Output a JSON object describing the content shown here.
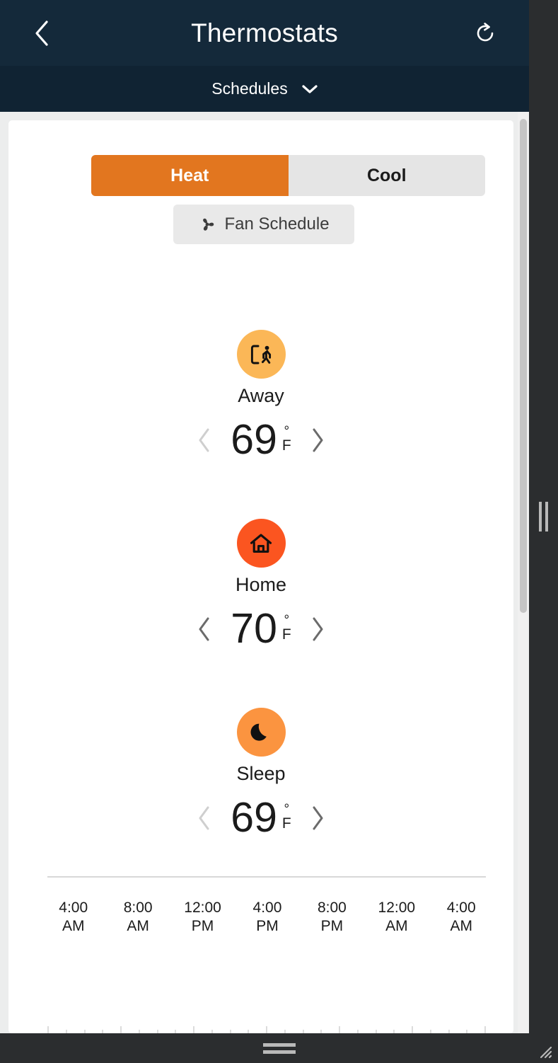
{
  "window": {
    "header": {
      "title": "Thermostats",
      "back_icon": "chevron-left-icon",
      "refresh_icon": "refresh-icon"
    },
    "subbar": {
      "label": "Schedules",
      "chevron_icon": "chevron-down-icon"
    }
  },
  "mode_tabs": {
    "items": [
      {
        "label": "Heat",
        "active": true
      },
      {
        "label": "Cool",
        "active": false
      }
    ]
  },
  "fan_schedule": {
    "label": "Fan Schedule",
    "icon": "fan-icon"
  },
  "comfort_settings": [
    {
      "name": "Away",
      "icon": "person-exit-icon",
      "circle_color": "#fbb757",
      "temperature": "69",
      "degree_symbol": "°",
      "unit": "F",
      "decrease_enabled": false,
      "increase_enabled": true
    },
    {
      "name": "Home",
      "icon": "house-icon",
      "circle_color": "#fb5520",
      "temperature": "70",
      "degree_symbol": "°",
      "unit": "F",
      "decrease_enabled": true,
      "increase_enabled": true
    },
    {
      "name": "Sleep",
      "icon": "moon-icon",
      "circle_color": "#fb9440",
      "temperature": "69",
      "degree_symbol": "°",
      "unit": "F",
      "decrease_enabled": false,
      "increase_enabled": true
    }
  ],
  "time_axis": {
    "labels": [
      {
        "time": "4:00",
        "meridiem": "AM"
      },
      {
        "time": "8:00",
        "meridiem": "AM"
      },
      {
        "time": "12:00",
        "meridiem": "PM"
      },
      {
        "time": "4:00",
        "meridiem": "PM"
      },
      {
        "time": "8:00",
        "meridiem": "PM"
      },
      {
        "time": "12:00",
        "meridiem": "AM"
      },
      {
        "time": "4:00",
        "meridiem": "AM"
      }
    ]
  },
  "colors": {
    "header_bg": "#14293a",
    "subbar_bg": "#102333",
    "accent_orange": "#e2761f",
    "page_bg": "#eceded",
    "chrome_dark": "#2b2d2f"
  }
}
